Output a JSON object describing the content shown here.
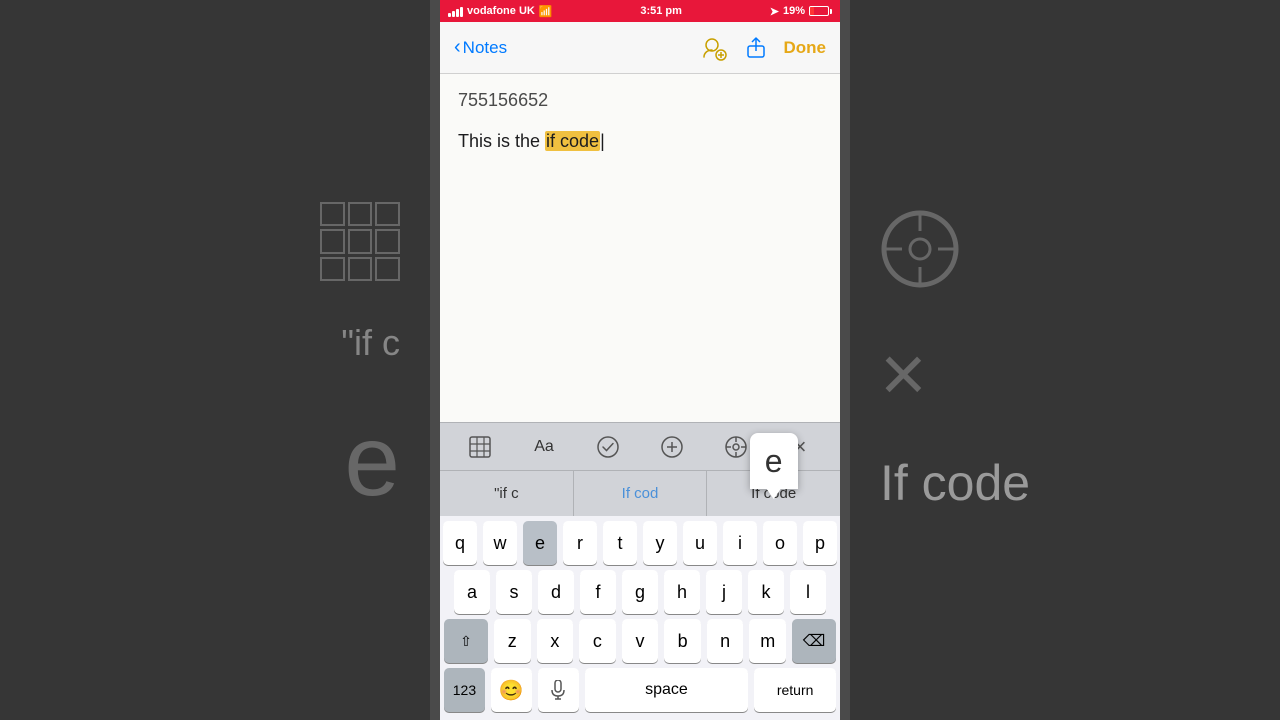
{
  "statusBar": {
    "carrier": "vodafone UK",
    "time": "3:51 pm",
    "battery": "19%",
    "wifiIcon": "wifi-icon",
    "locationIcon": "location-icon"
  },
  "navBar": {
    "backLabel": "Notes",
    "doneLabel": "Done"
  },
  "note": {
    "id": "755156652",
    "textBefore": "This is the ",
    "highlight": "if code",
    "cursor": "|"
  },
  "toolbar": {
    "tableIcon": "⊞",
    "fontIcon": "Aa",
    "checkIcon": "✓",
    "plusIcon": "+",
    "pencilIcon": "✎",
    "closeIcon": "×"
  },
  "autocomplete": {
    "items": [
      {
        "label": "\"if c",
        "type": "quoted"
      },
      {
        "label": "If cod",
        "type": "suggestion"
      },
      {
        "label": "If code",
        "type": "suggestion"
      }
    ]
  },
  "keyPopup": {
    "letter": "e"
  },
  "keyboard": {
    "rows": [
      [
        "q",
        "w",
        "e",
        "r",
        "t",
        "y",
        "u",
        "i",
        "o",
        "p"
      ],
      [
        "a",
        "s",
        "d",
        "f",
        "g",
        "h",
        "j",
        "k",
        "l"
      ],
      [
        "z",
        "x",
        "c",
        "v",
        "b",
        "n",
        "m"
      ]
    ],
    "bottomRow": {
      "numbers": "123",
      "emoji": "😊",
      "mic": "🎤",
      "space": "space",
      "return": "return"
    }
  },
  "bgLeft": {
    "quoteText": "\"if c",
    "keyE": "e"
  },
  "bgRight": {
    "circleIcon": "pencil-bg-icon",
    "xText": "×",
    "ifCodeText": "If code"
  }
}
